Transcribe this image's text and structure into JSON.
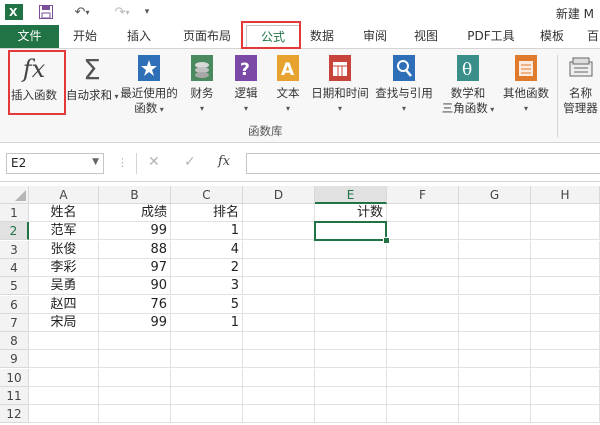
{
  "window": {
    "title": "新建 M"
  },
  "tabs": [
    "文件",
    "开始",
    "插入",
    "页面布局",
    "公式",
    "数据",
    "审阅",
    "视图",
    "PDF工具",
    "模板",
    "百"
  ],
  "ribbon": {
    "buttons": [
      {
        "label": "插入函数"
      },
      {
        "label": "自动求和"
      },
      {
        "label": "最近使用的",
        "label2": "函数"
      },
      {
        "label": "财务"
      },
      {
        "label": "逻辑"
      },
      {
        "label": "文本"
      },
      {
        "label": "日期和时间"
      },
      {
        "label": "查找与引用"
      },
      {
        "label": "数学和",
        "label2": "三角函数"
      },
      {
        "label": "其他函数"
      },
      {
        "label": "名称",
        "label2": "管理器"
      }
    ],
    "group_label": "函数库",
    "fx_glyph": "fx",
    "sigma_glyph": "Σ"
  },
  "formula_bar": {
    "name_box": "E2",
    "formula": "",
    "fx": "fx"
  },
  "columns": [
    "A",
    "B",
    "C",
    "D",
    "E",
    "F",
    "G",
    "H"
  ],
  "rows": [
    "1",
    "2",
    "3",
    "4",
    "5",
    "6",
    "7",
    "8",
    "9",
    "10",
    "11",
    "12"
  ],
  "cells": {
    "A1": "姓名",
    "B1": "成绩",
    "C1": "排名",
    "E1": "计数",
    "A2": "范军",
    "B2": "99",
    "C2": "1",
    "A3": "张俊",
    "B3": "88",
    "C3": "4",
    "A4": "李彩",
    "B4": "97",
    "C4": "2",
    "A5": "吴勇",
    "B5": "90",
    "C5": "3",
    "A6": "赵四",
    "B6": "76",
    "C6": "5",
    "A7": "宋局",
    "B7": "99",
    "C7": "1"
  },
  "selected_cell": "E2",
  "colors": {
    "excel_green": "#217346",
    "highlight_red": "#e23a3a"
  }
}
